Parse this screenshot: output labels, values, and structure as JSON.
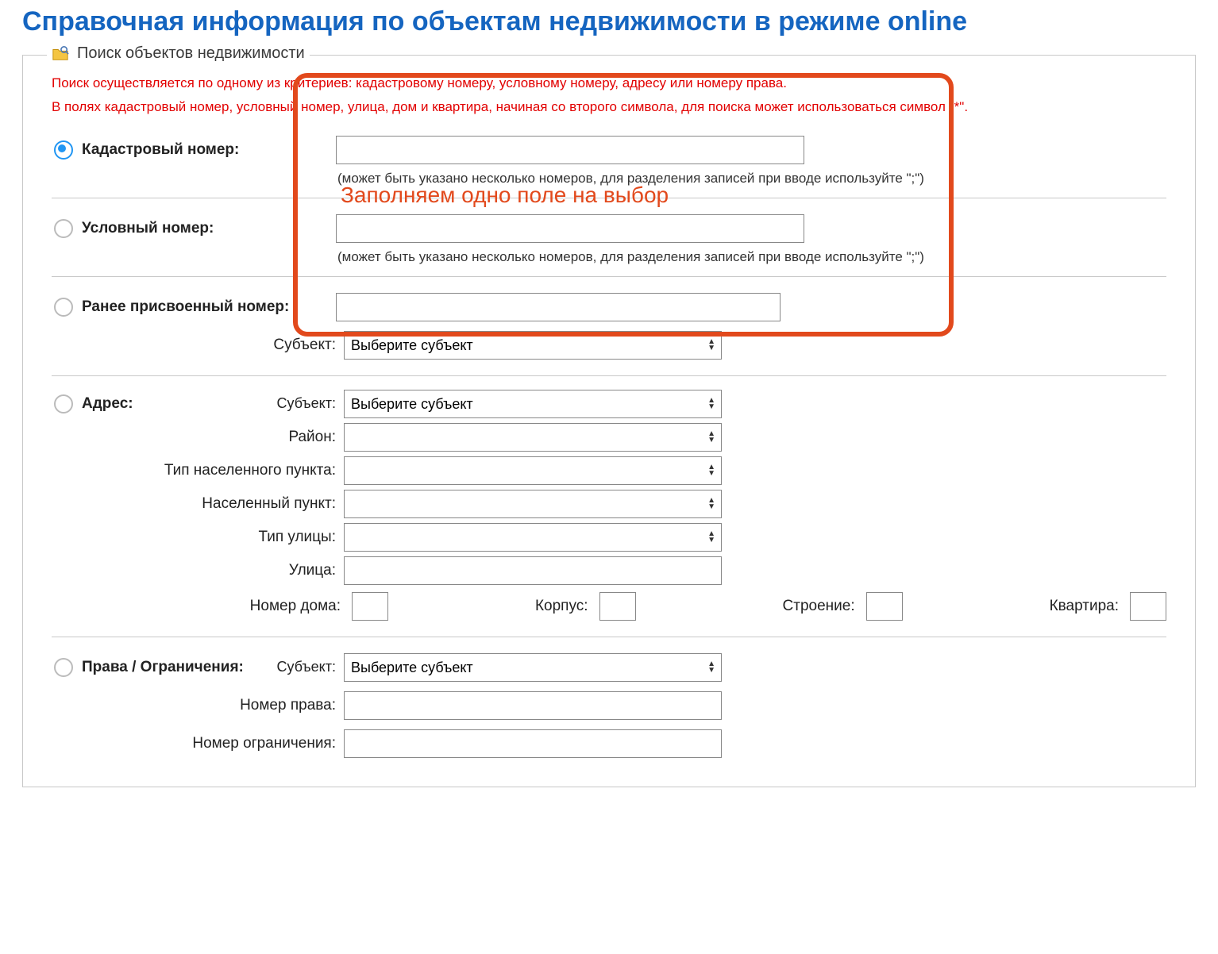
{
  "title": "Справочная информация по объектам недвижимости в режиме online",
  "search": {
    "legend": "Поиск объектов недвижимости",
    "hint1": "Поиск осуществляется по одному из критериев: кадастровому номеру, условному номеру, адресу или номеру права.",
    "hint2": "В полях кадастровый номер, условный номер, улица, дом и квартира, начиная со второго символа, для поиска может использоваться символ \"*\".",
    "cadastral": {
      "label": "Кадастровый номер:",
      "value": "",
      "hint": "(может быть указано несколько номеров, для разделения записей при вводе используйте \";\")"
    },
    "conditional": {
      "label": "Условный номер:",
      "value": "",
      "hint": "(может быть указано несколько номеров, для разделения записей при вводе используйте \";\")"
    },
    "previous": {
      "label": "Ранее присвоенный номер:",
      "value": "",
      "subject_label": "Субъект:",
      "subject_value": "Выберите субъект"
    },
    "address": {
      "label": "Адрес:",
      "subject_label": "Субъект:",
      "subject_value": "Выберите субъект",
      "district_label": "Район:",
      "district_value": "",
      "settlement_type_label": "Тип населенного пункта:",
      "settlement_type_value": "",
      "settlement_label": "Населенный пункт:",
      "settlement_value": "",
      "street_type_label": "Тип улицы:",
      "street_type_value": "",
      "street_label": "Улица:",
      "street_value": "",
      "house_label": "Номер дома:",
      "house_value": "",
      "korpus_label": "Корпус:",
      "korpus_value": "",
      "building_label": "Строение:",
      "building_value": "",
      "apartment_label": "Квартира:",
      "apartment_value": ""
    },
    "rights": {
      "label": "Права / Ограничения:",
      "subject_label": "Субъект:",
      "subject_value": "Выберите субъект",
      "right_number_label": "Номер права:",
      "right_number_value": "",
      "restriction_number_label": "Номер ограничения:",
      "restriction_number_value": ""
    }
  },
  "annotation": {
    "text": "Заполняем одно поле на выбор"
  }
}
